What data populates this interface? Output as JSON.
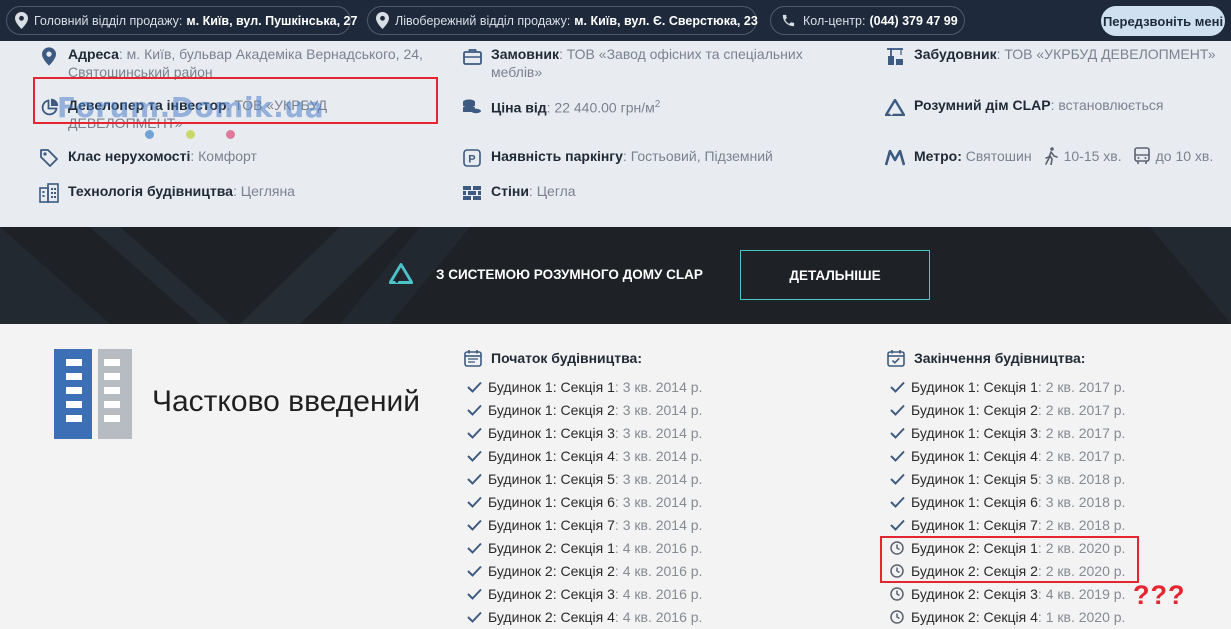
{
  "topbar": {
    "main_office_label": "Головний відділ продажу:",
    "main_office_addr": "м. Київ, вул. Пушкінська, 27",
    "left_office_label": "Лівобережний відділ продажу:",
    "left_office_addr": "м. Київ, вул. Є. Сверстюка, 23",
    "callcenter_label": "Кол-центр:",
    "callcenter_phone": "(044) 379 47 99",
    "callback_button": "Передзвоніть мені"
  },
  "info": {
    "address": {
      "key": "Адреса",
      "value": ": м. Київ, бульвар Академіка Вернадського, 24,",
      "value2": "Святошинський район"
    },
    "customer": {
      "key": "Замовник",
      "value": ": ТОВ «Завод офісних та спеціальних",
      "value2": "меблів»"
    },
    "builder": {
      "key": "Забудовник",
      "value": ": ТОВ «УКРБУД ДЕВЕЛОПМЕНТ»"
    },
    "developer": {
      "key": "Девелопер та інвестор",
      "value": ": ТОВ «УКРБУД",
      "value2": "ДЕВЕЛОПМЕНТ»"
    },
    "price": {
      "key": "Ціна від",
      "value": ": 22 440.00 грн/м",
      "sup": "2"
    },
    "smarthome": {
      "key": "Розумний дім CLAP",
      "value": ": встановлюється"
    },
    "class": {
      "key": "Клас нерухомості",
      "value": ": Комфорт"
    },
    "parking": {
      "key": "Наявність паркінгу",
      "value": ": Гостьовий, Підземний"
    },
    "metro": {
      "key": "Метро:",
      "station": "Святошин",
      "walk": "10-15 хв.",
      "bus": "до 10 хв."
    },
    "technology": {
      "key": "Технологія будівництва",
      "value": ": Цегляна"
    },
    "walls": {
      "key": "Стіни",
      "value": ": Цегла"
    }
  },
  "watermark": "Forum.Domik.ua",
  "banner": {
    "text": "З СИСТЕМОЮ РОЗУМНОГО ДОМУ CLAP",
    "button": "ДЕТАЛЬНІШЕ"
  },
  "status": "Частково введений",
  "start": {
    "title": "Початок будівництва:",
    "items": [
      {
        "label": "Будинок 1: Секція 1",
        "value": ": 3 кв. 2014 р."
      },
      {
        "label": "Будинок 1: Секція 2",
        "value": ": 3 кв. 2014 р."
      },
      {
        "label": "Будинок 1: Секція 3",
        "value": ": 3 кв. 2014 р."
      },
      {
        "label": "Будинок 1: Секція 4",
        "value": ": 3 кв. 2014 р."
      },
      {
        "label": "Будинок 1: Секція 5",
        "value": ": 3 кв. 2014 р."
      },
      {
        "label": "Будинок 1: Секція 6",
        "value": ": 3 кв. 2014 р."
      },
      {
        "label": "Будинок 1: Секція 7",
        "value": ": 3 кв. 2014 р."
      },
      {
        "label": "Будинок 2: Секція 1",
        "value": ": 4 кв. 2016 р."
      },
      {
        "label": "Будинок 2: Секція 2",
        "value": ": 4 кв. 2016 р."
      },
      {
        "label": "Будинок 2: Секція 3",
        "value": ": 4 кв. 2016 р."
      },
      {
        "label": "Будинок 2: Секція 4",
        "value": ": 4 кв. 2016 р."
      }
    ]
  },
  "end": {
    "title": "Закінчення будівництва:",
    "items": [
      {
        "label": "Будинок 1: Секція 1",
        "value": ": 2 кв. 2017 р.",
        "done": true
      },
      {
        "label": "Будинок 1: Секція 2",
        "value": ": 2 кв. 2017 р.",
        "done": true
      },
      {
        "label": "Будинок 1: Секція 3",
        "value": ": 2 кв. 2017 р.",
        "done": true
      },
      {
        "label": "Будинок 1: Секція 4",
        "value": ": 2 кв. 2017 р.",
        "done": true
      },
      {
        "label": "Будинок 1: Секція 5",
        "value": ": 3 кв. 2018 р.",
        "done": true
      },
      {
        "label": "Будинок 1: Секція 6",
        "value": ": 3 кв. 2018 р.",
        "done": true
      },
      {
        "label": "Будинок 1: Секція 7",
        "value": ": 2 кв. 2018 р.",
        "done": true
      },
      {
        "label": "Будинок 2: Секція 1",
        "value": ": 2 кв. 2020 р.",
        "done": false
      },
      {
        "label": "Будинок 2: Секція 2",
        "value": ": 2 кв. 2020 р.",
        "done": false
      },
      {
        "label": "Будинок 2: Секція 3",
        "value": ": 4 кв. 2019 р.",
        "done": false
      },
      {
        "label": "Будинок 2: Секція 4",
        "value": ": 1 кв. 2020 р.",
        "done": false
      }
    ]
  },
  "annotation_qmarks": "???",
  "colors": {
    "topbar": "#1e2a3b",
    "accent_blue": "#3d6fb6",
    "highlight_red": "#e3262f",
    "banner": "#1e2227",
    "teal": "#4bc3c8"
  }
}
